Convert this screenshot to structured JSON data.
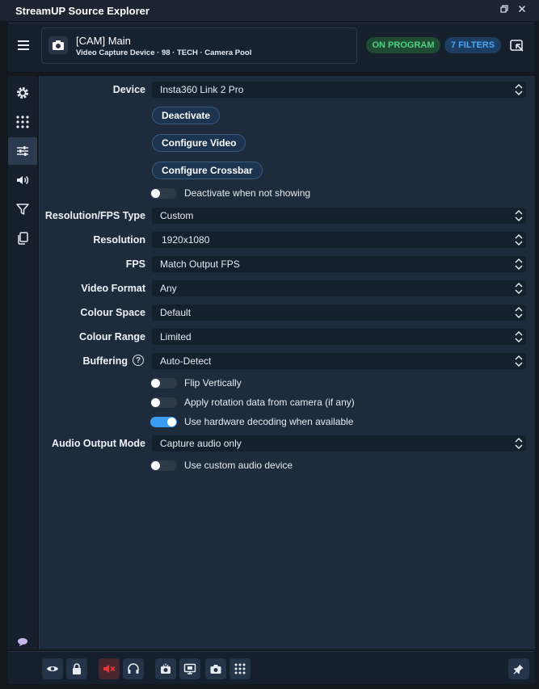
{
  "app": {
    "title": "StreamUP Source Explorer"
  },
  "source": {
    "name": "[CAM] Main",
    "subtitle": "Video Capture Device · 98 · TECH · Camera Pool",
    "badge_program": "ON PROGRAM",
    "badge_filters": "7 FILTERS"
  },
  "props": {
    "device": {
      "label": "Device",
      "value": "Insta360 Link 2 Pro"
    },
    "buttons": [
      "Deactivate",
      "Configure Video",
      "Configure Crossbar"
    ],
    "deactivate_toggle": {
      "label": "Deactivate when not showing",
      "on": false
    },
    "res_type": {
      "label": "Resolution/FPS Type",
      "value": "Custom"
    },
    "resolution": {
      "label": "Resolution",
      "value": "1920x1080"
    },
    "fps": {
      "label": "FPS",
      "value": "Match Output FPS"
    },
    "video_format": {
      "label": "Video Format",
      "value": "Any"
    },
    "colour_space": {
      "label": "Colour Space",
      "value": "Default"
    },
    "colour_range": {
      "label": "Colour Range",
      "value": "Limited"
    },
    "buffering": {
      "label": "Buffering",
      "value": "Auto-Detect",
      "help": "?"
    },
    "flip_toggle": {
      "label": "Flip Vertically",
      "on": false
    },
    "rotation_toggle": {
      "label": "Apply rotation data from camera (if any)",
      "on": false
    },
    "hw_toggle": {
      "label": "Use hardware decoding when available",
      "on": true
    },
    "audio_mode": {
      "label": "Audio Output Mode",
      "value": "Capture audio only"
    },
    "custom_audio_toggle": {
      "label": "Use custom audio device",
      "on": false
    }
  },
  "sidebar": [
    "gear-icon",
    "grid-icon",
    "sliders-icon",
    "speaker-icon",
    "filter-icon",
    "copy-icon"
  ],
  "colors": {
    "accent": "#3b9bf0",
    "program": "#4fd183",
    "filters": "#4aa6f5",
    "muted": "#e03a3a"
  }
}
